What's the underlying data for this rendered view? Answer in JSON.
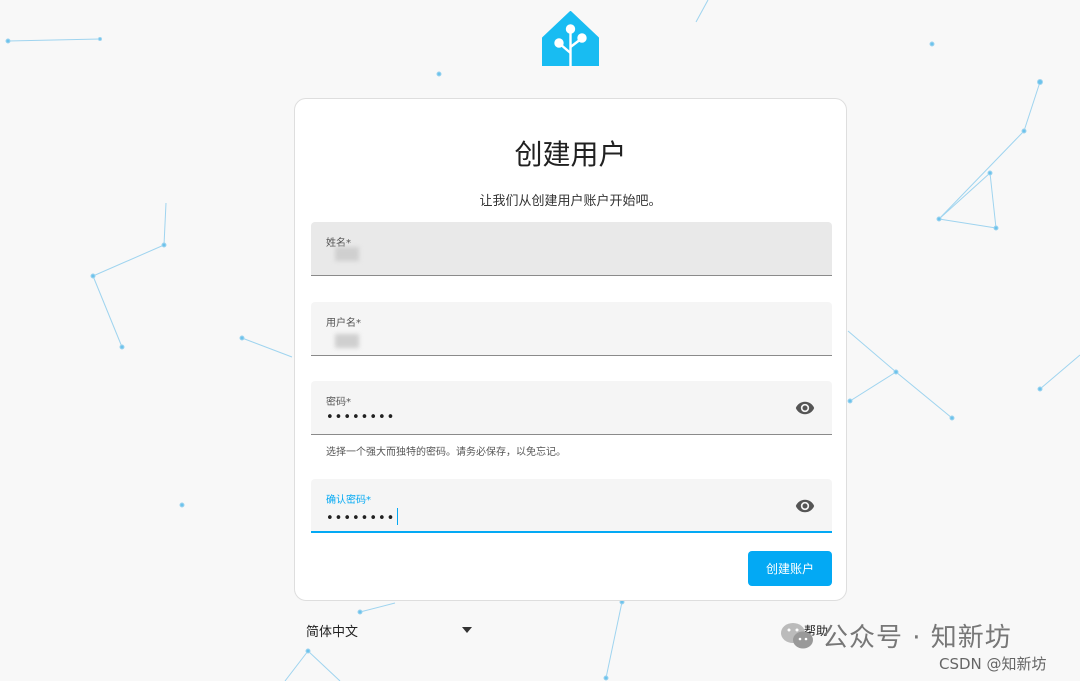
{
  "page": {
    "title": "创建用户",
    "subtitle": "让我们从创建用户账户开始吧。"
  },
  "form": {
    "name": {
      "label": "姓名*",
      "value": ""
    },
    "username": {
      "label": "用户名*",
      "value": ""
    },
    "password": {
      "label": "密码*",
      "value": "••••••••"
    },
    "password_helper": "选择一个强大而独特的密码。请务必保存，以免忘记。",
    "confirm_password": {
      "label": "确认密码*",
      "value": "••••••••"
    },
    "submit_label": "创建账户"
  },
  "footer": {
    "language": "简体中文",
    "help": "帮助"
  },
  "watermark": {
    "text": "公众号 · 知新坊",
    "source": "CSDN @知新坊"
  },
  "icons": {
    "logo": "home-assistant-logo",
    "password_toggle": "eye-icon",
    "language_dropdown": "caret-down-icon"
  },
  "colors": {
    "accent": "#03a9f4",
    "network_lines": "#8fd0ef"
  }
}
